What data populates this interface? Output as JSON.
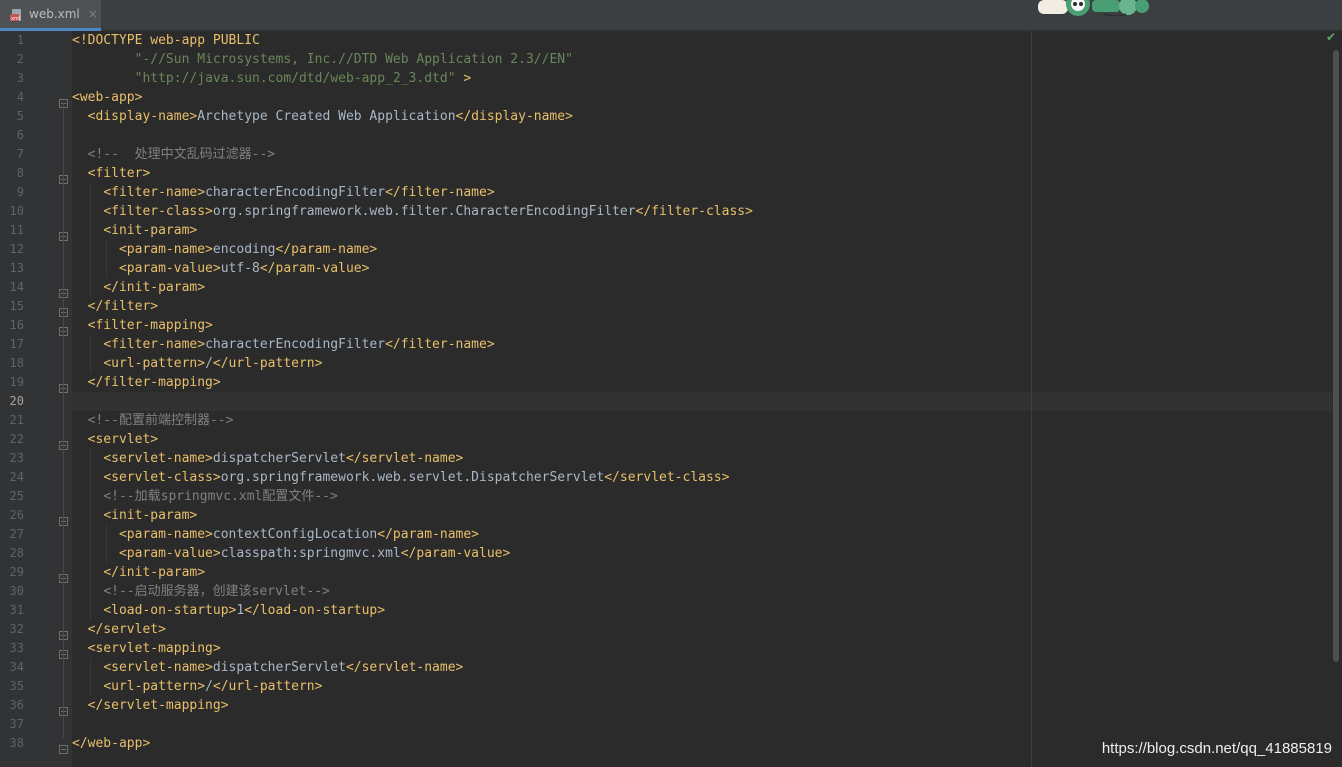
{
  "tab": {
    "label": "web.xml",
    "close": "×",
    "icon": "xml-file-icon"
  },
  "inspection_status": "✔",
  "watermark": "https://blog.csdn.net/qq_41885819",
  "lines": [
    {
      "n": "1",
      "segs": [
        [
          "doc",
          "<!DOCTYPE web-app PUBLIC"
        ]
      ]
    },
    {
      "n": "2",
      "segs": [
        [
          "txt",
          "        "
        ],
        [
          "str",
          "\"-//Sun Microsystems, Inc.//DTD Web Application 2.3//EN\""
        ]
      ]
    },
    {
      "n": "3",
      "segs": [
        [
          "txt",
          "        "
        ],
        [
          "str",
          "\"http://java.sun.com/dtd/web-app_2_3.dtd\""
        ],
        [
          "doc",
          " >"
        ]
      ]
    },
    {
      "n": "4",
      "segs": [
        [
          "tag",
          "<web-app>"
        ]
      ]
    },
    {
      "n": "5",
      "segs": [
        [
          "txt",
          "  "
        ],
        [
          "tag",
          "<display-name>"
        ],
        [
          "txt",
          "Archetype Created Web Application"
        ],
        [
          "tag",
          "</display-name>"
        ]
      ]
    },
    {
      "n": "6",
      "segs": []
    },
    {
      "n": "7",
      "segs": [
        [
          "txt",
          "  "
        ],
        [
          "cmt",
          "<!--  处理中文乱码过滤器-->"
        ]
      ]
    },
    {
      "n": "8",
      "segs": [
        [
          "txt",
          "  "
        ],
        [
          "tag",
          "<filter>"
        ]
      ]
    },
    {
      "n": "9",
      "segs": [
        [
          "txt",
          "    "
        ],
        [
          "tag",
          "<filter-name>"
        ],
        [
          "txt",
          "characterEncodingFilter"
        ],
        [
          "tag",
          "</filter-name>"
        ]
      ]
    },
    {
      "n": "10",
      "segs": [
        [
          "txt",
          "    "
        ],
        [
          "tag",
          "<filter-class>"
        ],
        [
          "txt",
          "org.springframework.web.filter.CharacterEncodingFilter"
        ],
        [
          "tag",
          "</filter-class>"
        ]
      ]
    },
    {
      "n": "11",
      "segs": [
        [
          "txt",
          "    "
        ],
        [
          "tag",
          "<init-param>"
        ]
      ]
    },
    {
      "n": "12",
      "segs": [
        [
          "txt",
          "      "
        ],
        [
          "tag",
          "<param-name>"
        ],
        [
          "txt",
          "encoding"
        ],
        [
          "tag",
          "</param-name>"
        ]
      ]
    },
    {
      "n": "13",
      "segs": [
        [
          "txt",
          "      "
        ],
        [
          "tag",
          "<param-value>"
        ],
        [
          "txt",
          "utf-8"
        ],
        [
          "tag",
          "</param-value>"
        ]
      ]
    },
    {
      "n": "14",
      "segs": [
        [
          "txt",
          "    "
        ],
        [
          "tag",
          "</init-param>"
        ]
      ]
    },
    {
      "n": "15",
      "segs": [
        [
          "txt",
          "  "
        ],
        [
          "tag",
          "</filter>"
        ]
      ]
    },
    {
      "n": "16",
      "segs": [
        [
          "txt",
          "  "
        ],
        [
          "tag",
          "<filter-mapping>"
        ]
      ]
    },
    {
      "n": "17",
      "segs": [
        [
          "txt",
          "    "
        ],
        [
          "tag",
          "<filter-name>"
        ],
        [
          "txt",
          "characterEncodingFilter"
        ],
        [
          "tag",
          "</filter-name>"
        ]
      ]
    },
    {
      "n": "18",
      "segs": [
        [
          "txt",
          "    "
        ],
        [
          "tag",
          "<url-pattern>"
        ],
        [
          "txt",
          "/"
        ],
        [
          "tag",
          "</url-pattern>"
        ]
      ]
    },
    {
      "n": "19",
      "segs": [
        [
          "txt",
          "  "
        ],
        [
          "tag",
          "</filter-mapping>"
        ]
      ]
    },
    {
      "n": "20",
      "segs": []
    },
    {
      "n": "21",
      "segs": [
        [
          "txt",
          "  "
        ],
        [
          "cmt",
          "<!--配置前端控制器-->"
        ]
      ]
    },
    {
      "n": "22",
      "segs": [
        [
          "txt",
          "  "
        ],
        [
          "tag",
          "<servlet>"
        ]
      ]
    },
    {
      "n": "23",
      "segs": [
        [
          "txt",
          "    "
        ],
        [
          "tag",
          "<servlet-name>"
        ],
        [
          "txt",
          "dispatcherServlet"
        ],
        [
          "tag",
          "</servlet-name>"
        ]
      ]
    },
    {
      "n": "24",
      "segs": [
        [
          "txt",
          "    "
        ],
        [
          "tag",
          "<servlet-class>"
        ],
        [
          "txt",
          "org.springframework.web.servlet.DispatcherServlet"
        ],
        [
          "tag",
          "</servlet-class>"
        ]
      ]
    },
    {
      "n": "25",
      "segs": [
        [
          "txt",
          "    "
        ],
        [
          "cmt",
          "<!--加载springmvc.xml配置文件-->"
        ]
      ]
    },
    {
      "n": "26",
      "segs": [
        [
          "txt",
          "    "
        ],
        [
          "tag",
          "<init-param>"
        ]
      ]
    },
    {
      "n": "27",
      "segs": [
        [
          "txt",
          "      "
        ],
        [
          "tag",
          "<param-name>"
        ],
        [
          "txt",
          "contextConfigLocation"
        ],
        [
          "tag",
          "</param-name>"
        ]
      ]
    },
    {
      "n": "28",
      "segs": [
        [
          "txt",
          "      "
        ],
        [
          "tag",
          "<param-value>"
        ],
        [
          "txt",
          "classpath:springmvc.xml"
        ],
        [
          "tag",
          "</param-value>"
        ]
      ]
    },
    {
      "n": "29",
      "segs": [
        [
          "txt",
          "    "
        ],
        [
          "tag",
          "</init-param>"
        ]
      ]
    },
    {
      "n": "30",
      "segs": [
        [
          "txt",
          "    "
        ],
        [
          "cmt",
          "<!--启动服务器，创建该servlet-->"
        ]
      ]
    },
    {
      "n": "31",
      "segs": [
        [
          "txt",
          "    "
        ],
        [
          "tag",
          "<load-on-startup>"
        ],
        [
          "txt",
          "1"
        ],
        [
          "tag",
          "</load-on-startup>"
        ]
      ]
    },
    {
      "n": "32",
      "segs": [
        [
          "txt",
          "  "
        ],
        [
          "tag",
          "</servlet>"
        ]
      ]
    },
    {
      "n": "33",
      "segs": [
        [
          "txt",
          "  "
        ],
        [
          "tag",
          "<servlet-mapping>"
        ]
      ]
    },
    {
      "n": "34",
      "segs": [
        [
          "txt",
          "    "
        ],
        [
          "tag",
          "<servlet-name>"
        ],
        [
          "txt",
          "dispatcherServlet"
        ],
        [
          "tag",
          "</servlet-name>"
        ]
      ]
    },
    {
      "n": "35",
      "segs": [
        [
          "txt",
          "    "
        ],
        [
          "tag",
          "<url-pattern>"
        ],
        [
          "txt",
          "/"
        ],
        [
          "tag",
          "</url-pattern>"
        ]
      ]
    },
    {
      "n": "36",
      "segs": [
        [
          "txt",
          "  "
        ],
        [
          "tag",
          "</servlet-mapping>"
        ]
      ]
    },
    {
      "n": "37",
      "segs": []
    },
    {
      "n": "38",
      "segs": [
        [
          "tag",
          "</web-app>"
        ]
      ]
    }
  ],
  "current_line": "20",
  "fold_markers": [
    "4",
    "8",
    "11",
    "14",
    "15",
    "16",
    "19",
    "22",
    "26",
    "29",
    "32",
    "33",
    "36",
    "38"
  ]
}
